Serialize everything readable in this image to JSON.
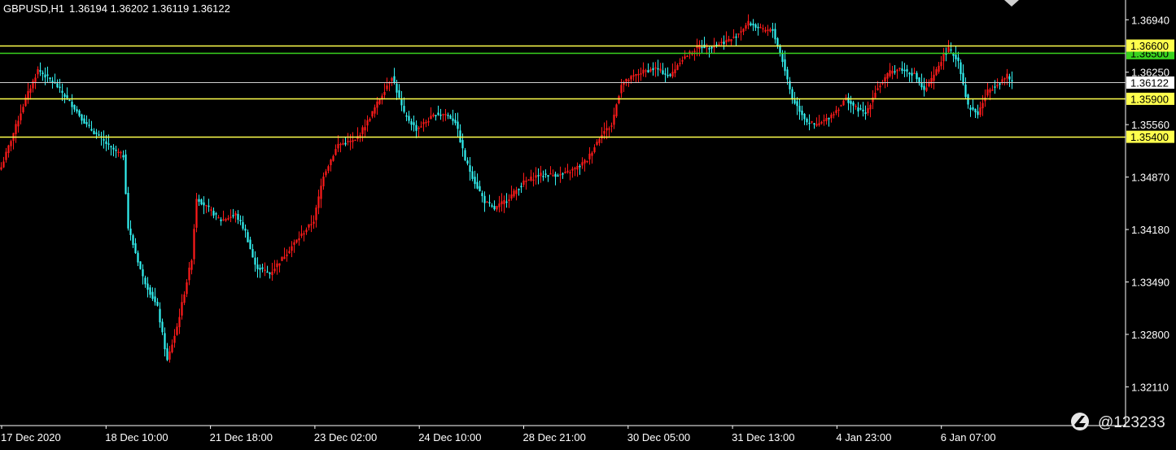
{
  "header": {
    "symbol": "GBPUSD,H1",
    "ohlc": "1.36194 1.36202 1.36119 1.36122"
  },
  "watermark": {
    "handle": "@123233",
    "icon": "app-logo-icon"
  },
  "colors": {
    "background": "#000000",
    "bull": "#ff1a1a",
    "bear": "#33f2f2",
    "level": "#ffff4d",
    "green_level": "#39d21e",
    "current_price": "#cfcfcf",
    "axis": "#ffffff"
  },
  "chart_data": {
    "type": "candlestick",
    "title": "GBPUSD,H1",
    "ylim": [
      1.316,
      1.372
    ],
    "y_ticks": [
      "1.36940",
      "1.36250",
      "1.35560",
      "1.34870",
      "1.34180",
      "1.33490",
      "1.32800",
      "1.32110"
    ],
    "x_ticks": [
      "17 Dec 2020",
      "18 Dec 10:00",
      "21 Dec 18:00",
      "23 Dec 02:00",
      "24 Dec 10:00",
      "28 Dec 21:00",
      "30 Dec 05:00",
      "31 Dec 13:00",
      "4 Jan 23:00",
      "6 Jan 07:00"
    ],
    "levels": [
      {
        "label": "1.36600",
        "value": 1.366,
        "color": "#ffff4d"
      },
      {
        "label": "1.36500",
        "value": 1.365,
        "color": "#39d21e"
      },
      {
        "label": "1.35900",
        "value": 1.359,
        "color": "#ffff4d"
      },
      {
        "label": "1.35400",
        "value": 1.354,
        "color": "#ffff4d"
      }
    ],
    "current_price": {
      "label": "1.36122",
      "value": 1.36122
    },
    "close_anchors": [
      [
        0,
        1.35
      ],
      [
        10,
        1.359
      ],
      [
        15,
        1.3628
      ],
      [
        22,
        1.361
      ],
      [
        30,
        1.3578
      ],
      [
        35,
        1.3555
      ],
      [
        45,
        1.3525
      ],
      [
        50,
        1.3515
      ],
      [
        52,
        1.342
      ],
      [
        58,
        1.3355
      ],
      [
        64,
        1.3315
      ],
      [
        68,
        1.3245
      ],
      [
        72,
        1.329
      ],
      [
        78,
        1.338
      ],
      [
        80,
        1.346
      ],
      [
        85,
        1.3445
      ],
      [
        90,
        1.343
      ],
      [
        96,
        1.3438
      ],
      [
        100,
        1.3415
      ],
      [
        104,
        1.337
      ],
      [
        110,
        1.336
      ],
      [
        120,
        1.34
      ],
      [
        128,
        1.343
      ],
      [
        132,
        1.349
      ],
      [
        138,
        1.353
      ],
      [
        145,
        1.3535
      ],
      [
        150,
        1.356
      ],
      [
        155,
        1.359
      ],
      [
        160,
        1.362
      ],
      [
        165,
        1.357
      ],
      [
        170,
        1.355
      ],
      [
        178,
        1.357
      ],
      [
        182,
        1.357
      ],
      [
        186,
        1.356
      ],
      [
        190,
        1.351
      ],
      [
        194,
        1.348
      ],
      [
        198,
        1.3455
      ],
      [
        202,
        1.3445
      ],
      [
        208,
        1.346
      ],
      [
        214,
        1.348
      ],
      [
        220,
        1.349
      ],
      [
        230,
        1.349
      ],
      [
        236,
        1.35
      ],
      [
        240,
        1.351
      ],
      [
        246,
        1.3545
      ],
      [
        250,
        1.3555
      ],
      [
        254,
        1.361
      ],
      [
        262,
        1.3625
      ],
      [
        268,
        1.363
      ],
      [
        274,
        1.362
      ],
      [
        278,
        1.364
      ],
      [
        282,
        1.365
      ],
      [
        286,
        1.366
      ],
      [
        290,
        1.3658
      ],
      [
        296,
        1.3665
      ],
      [
        300,
        1.367
      ],
      [
        306,
        1.369
      ],
      [
        312,
        1.368
      ],
      [
        316,
        1.368
      ],
      [
        320,
        1.364
      ],
      [
        324,
        1.359
      ],
      [
        330,
        1.356
      ],
      [
        334,
        1.3555
      ],
      [
        338,
        1.3563
      ],
      [
        342,
        1.3575
      ],
      [
        346,
        1.359
      ],
      [
        350,
        1.3578
      ],
      [
        354,
        1.357
      ],
      [
        358,
        1.36
      ],
      [
        364,
        1.3625
      ],
      [
        368,
        1.363
      ],
      [
        374,
        1.3622
      ],
      [
        378,
        1.36
      ],
      [
        382,
        1.362
      ],
      [
        386,
        1.3648
      ],
      [
        388,
        1.3655
      ],
      [
        392,
        1.364
      ],
      [
        396,
        1.358
      ],
      [
        400,
        1.357
      ],
      [
        404,
        1.36
      ],
      [
        408,
        1.361
      ],
      [
        412,
        1.362
      ],
      [
        414,
        1.3612
      ]
    ]
  }
}
